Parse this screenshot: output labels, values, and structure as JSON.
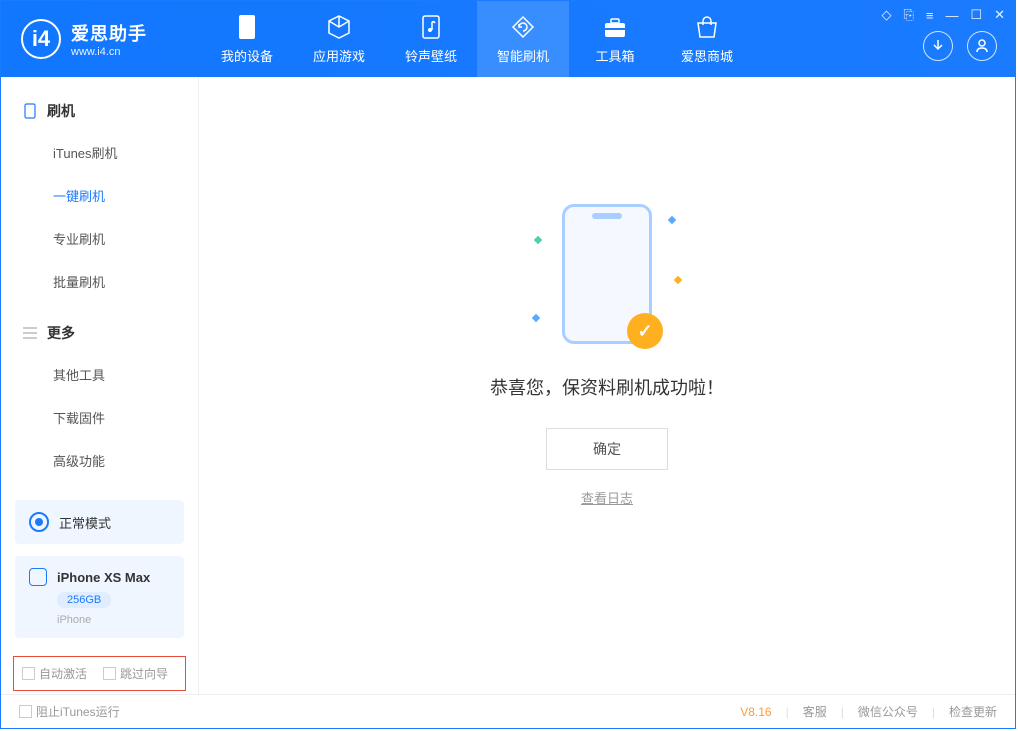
{
  "app": {
    "title": "爱思助手",
    "subtitle": "www.i4.cn"
  },
  "nav": {
    "tabs": [
      {
        "label": "我的设备",
        "icon": "device"
      },
      {
        "label": "应用游戏",
        "icon": "cube"
      },
      {
        "label": "铃声壁纸",
        "icon": "music"
      },
      {
        "label": "智能刷机",
        "icon": "refresh",
        "active": true
      },
      {
        "label": "工具箱",
        "icon": "toolbox"
      },
      {
        "label": "爱思商城",
        "icon": "store"
      }
    ]
  },
  "sidebar": {
    "sections": [
      {
        "title": "刷机",
        "icon": "phone-icon",
        "items": [
          {
            "label": "iTunes刷机"
          },
          {
            "label": "一键刷机",
            "active": true
          },
          {
            "label": "专业刷机"
          },
          {
            "label": "批量刷机"
          }
        ]
      },
      {
        "title": "更多",
        "icon": "list-icon",
        "items": [
          {
            "label": "其他工具"
          },
          {
            "label": "下载固件"
          },
          {
            "label": "高级功能"
          }
        ]
      }
    ],
    "status": {
      "label": "正常模式"
    },
    "device": {
      "name": "iPhone XS Max",
      "storage": "256GB",
      "type": "iPhone"
    },
    "checks": {
      "auto_activate": "自动激活",
      "skip_guide": "跳过向导"
    }
  },
  "main": {
    "success_text": "恭喜您，保资料刷机成功啦！",
    "ok_button": "确定",
    "log_link": "查看日志"
  },
  "footer": {
    "block_itunes": "阻止iTunes运行",
    "version": "V8.16",
    "links": [
      "客服",
      "微信公众号",
      "检查更新"
    ]
  }
}
